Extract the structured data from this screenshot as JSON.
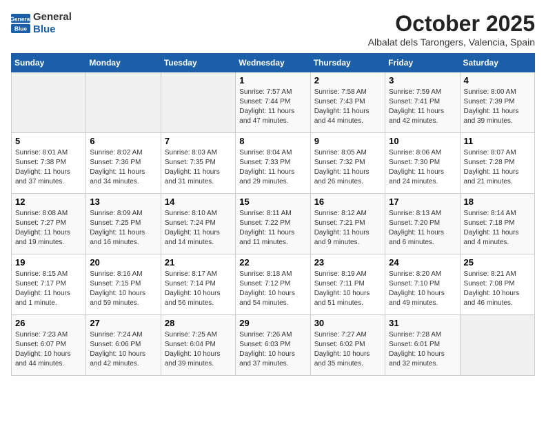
{
  "header": {
    "logo_general": "General",
    "logo_blue": "Blue",
    "month_title": "October 2025",
    "location": "Albalat dels Tarongers, Valencia, Spain"
  },
  "weekdays": [
    "Sunday",
    "Monday",
    "Tuesday",
    "Wednesday",
    "Thursday",
    "Friday",
    "Saturday"
  ],
  "weeks": [
    [
      {
        "day": "",
        "info": ""
      },
      {
        "day": "",
        "info": ""
      },
      {
        "day": "",
        "info": ""
      },
      {
        "day": "1",
        "info": "Sunrise: 7:57 AM\nSunset: 7:44 PM\nDaylight: 11 hours and 47 minutes."
      },
      {
        "day": "2",
        "info": "Sunrise: 7:58 AM\nSunset: 7:43 PM\nDaylight: 11 hours and 44 minutes."
      },
      {
        "day": "3",
        "info": "Sunrise: 7:59 AM\nSunset: 7:41 PM\nDaylight: 11 hours and 42 minutes."
      },
      {
        "day": "4",
        "info": "Sunrise: 8:00 AM\nSunset: 7:39 PM\nDaylight: 11 hours and 39 minutes."
      }
    ],
    [
      {
        "day": "5",
        "info": "Sunrise: 8:01 AM\nSunset: 7:38 PM\nDaylight: 11 hours and 37 minutes."
      },
      {
        "day": "6",
        "info": "Sunrise: 8:02 AM\nSunset: 7:36 PM\nDaylight: 11 hours and 34 minutes."
      },
      {
        "day": "7",
        "info": "Sunrise: 8:03 AM\nSunset: 7:35 PM\nDaylight: 11 hours and 31 minutes."
      },
      {
        "day": "8",
        "info": "Sunrise: 8:04 AM\nSunset: 7:33 PM\nDaylight: 11 hours and 29 minutes."
      },
      {
        "day": "9",
        "info": "Sunrise: 8:05 AM\nSunset: 7:32 PM\nDaylight: 11 hours and 26 minutes."
      },
      {
        "day": "10",
        "info": "Sunrise: 8:06 AM\nSunset: 7:30 PM\nDaylight: 11 hours and 24 minutes."
      },
      {
        "day": "11",
        "info": "Sunrise: 8:07 AM\nSunset: 7:28 PM\nDaylight: 11 hours and 21 minutes."
      }
    ],
    [
      {
        "day": "12",
        "info": "Sunrise: 8:08 AM\nSunset: 7:27 PM\nDaylight: 11 hours and 19 minutes."
      },
      {
        "day": "13",
        "info": "Sunrise: 8:09 AM\nSunset: 7:25 PM\nDaylight: 11 hours and 16 minutes."
      },
      {
        "day": "14",
        "info": "Sunrise: 8:10 AM\nSunset: 7:24 PM\nDaylight: 11 hours and 14 minutes."
      },
      {
        "day": "15",
        "info": "Sunrise: 8:11 AM\nSunset: 7:22 PM\nDaylight: 11 hours and 11 minutes."
      },
      {
        "day": "16",
        "info": "Sunrise: 8:12 AM\nSunset: 7:21 PM\nDaylight: 11 hours and 9 minutes."
      },
      {
        "day": "17",
        "info": "Sunrise: 8:13 AM\nSunset: 7:20 PM\nDaylight: 11 hours and 6 minutes."
      },
      {
        "day": "18",
        "info": "Sunrise: 8:14 AM\nSunset: 7:18 PM\nDaylight: 11 hours and 4 minutes."
      }
    ],
    [
      {
        "day": "19",
        "info": "Sunrise: 8:15 AM\nSunset: 7:17 PM\nDaylight: 11 hours and 1 minute."
      },
      {
        "day": "20",
        "info": "Sunrise: 8:16 AM\nSunset: 7:15 PM\nDaylight: 10 hours and 59 minutes."
      },
      {
        "day": "21",
        "info": "Sunrise: 8:17 AM\nSunset: 7:14 PM\nDaylight: 10 hours and 56 minutes."
      },
      {
        "day": "22",
        "info": "Sunrise: 8:18 AM\nSunset: 7:12 PM\nDaylight: 10 hours and 54 minutes."
      },
      {
        "day": "23",
        "info": "Sunrise: 8:19 AM\nSunset: 7:11 PM\nDaylight: 10 hours and 51 minutes."
      },
      {
        "day": "24",
        "info": "Sunrise: 8:20 AM\nSunset: 7:10 PM\nDaylight: 10 hours and 49 minutes."
      },
      {
        "day": "25",
        "info": "Sunrise: 8:21 AM\nSunset: 7:08 PM\nDaylight: 10 hours and 46 minutes."
      }
    ],
    [
      {
        "day": "26",
        "info": "Sunrise: 7:23 AM\nSunset: 6:07 PM\nDaylight: 10 hours and 44 minutes."
      },
      {
        "day": "27",
        "info": "Sunrise: 7:24 AM\nSunset: 6:06 PM\nDaylight: 10 hours and 42 minutes."
      },
      {
        "day": "28",
        "info": "Sunrise: 7:25 AM\nSunset: 6:04 PM\nDaylight: 10 hours and 39 minutes."
      },
      {
        "day": "29",
        "info": "Sunrise: 7:26 AM\nSunset: 6:03 PM\nDaylight: 10 hours and 37 minutes."
      },
      {
        "day": "30",
        "info": "Sunrise: 7:27 AM\nSunset: 6:02 PM\nDaylight: 10 hours and 35 minutes."
      },
      {
        "day": "31",
        "info": "Sunrise: 7:28 AM\nSunset: 6:01 PM\nDaylight: 10 hours and 32 minutes."
      },
      {
        "day": "",
        "info": ""
      }
    ]
  ]
}
